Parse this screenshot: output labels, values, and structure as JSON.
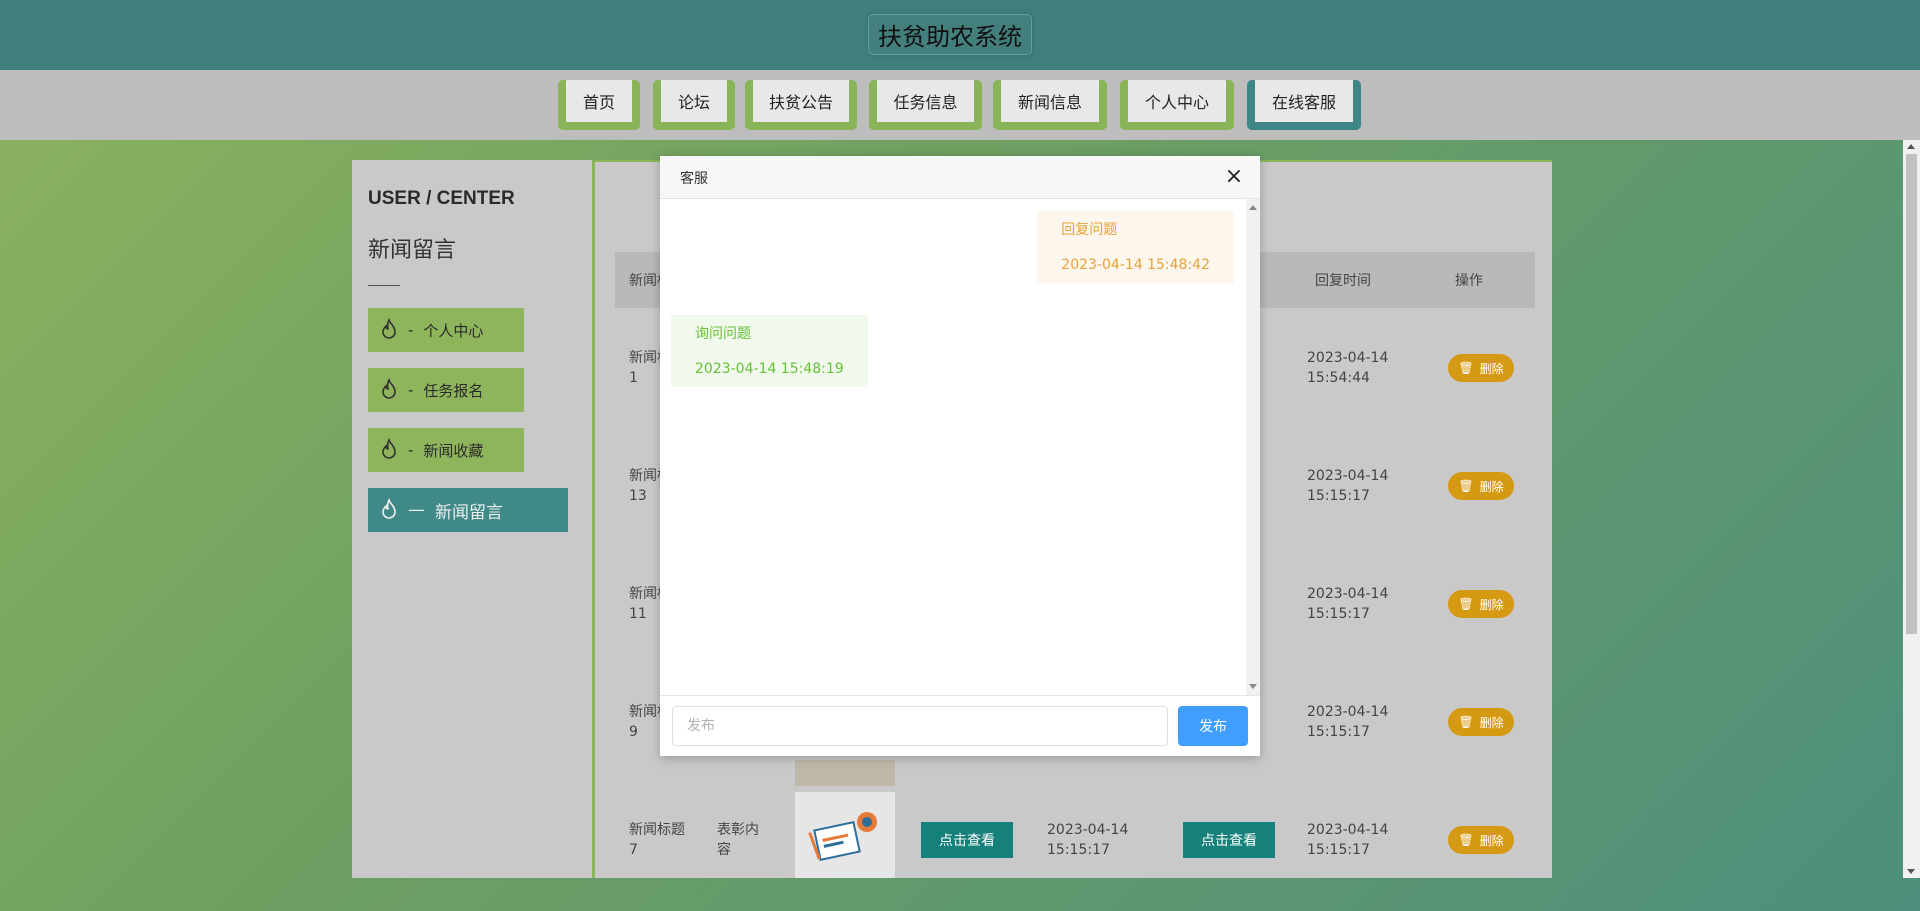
{
  "site": {
    "title": "扶贫助农系统"
  },
  "nav": {
    "items": [
      {
        "label": "首页"
      },
      {
        "label": "论坛"
      },
      {
        "label": "扶贫公告"
      },
      {
        "label": "任务信息"
      },
      {
        "label": "新闻信息"
      },
      {
        "label": "个人中心"
      },
      {
        "label": "在线客服",
        "active": true
      }
    ]
  },
  "sidebar": {
    "title": "USER / CENTER",
    "subtitle": "新闻留言",
    "items": [
      {
        "label": "个人中心",
        "prefix": "-"
      },
      {
        "label": "任务报名",
        "prefix": "-"
      },
      {
        "label": "新闻收藏",
        "prefix": "-"
      },
      {
        "label": "新闻留言",
        "prefix": "—",
        "active": true
      }
    ]
  },
  "table": {
    "headers": {
      "col1": "新闻标",
      "reply_time": "回复时间",
      "action": "操作"
    },
    "rows": [
      {
        "title": "新闻标\n1",
        "reply_time": "2023-04-14\n15:54:44",
        "delete_label": "删除"
      },
      {
        "title": "新闻标\n13",
        "reply_time": "2023-04-14\n15:15:17",
        "delete_label": "删除"
      },
      {
        "title": "新闻标\n11",
        "reply_time": "2023-04-14\n15:15:17",
        "delete_label": "删除"
      },
      {
        "title": "新闻标\n9",
        "reply_time": "2023-04-14\n15:15:17",
        "delete_label": "删除"
      },
      {
        "title": "新闻标题\n7",
        "content": "表彰内\n容",
        "view_label_1": "点击查看",
        "time": "2023-04-14\n15:15:17",
        "view_label_2": "点击查看",
        "reply_time": "2023-04-14\n15:15:17",
        "delete_label": "删除"
      }
    ]
  },
  "modal": {
    "title": "客服",
    "messages": [
      {
        "type": "reply",
        "text": "回复问题",
        "time": "2023-04-14 15:48:42"
      },
      {
        "type": "ask",
        "text": "询问问题",
        "time": "2023-04-14 15:48:19"
      }
    ],
    "input_placeholder": "发布",
    "send_label": "发布"
  },
  "colors": {
    "header": "#3f7e7b",
    "nav_green": "#8ab45a",
    "nav_active": "#3f8787",
    "reply_text": "#e6a23c",
    "ask_text": "#67c23a",
    "send_button": "#409eff",
    "delete_button": "#d69a12",
    "view_button": "#16807a"
  }
}
